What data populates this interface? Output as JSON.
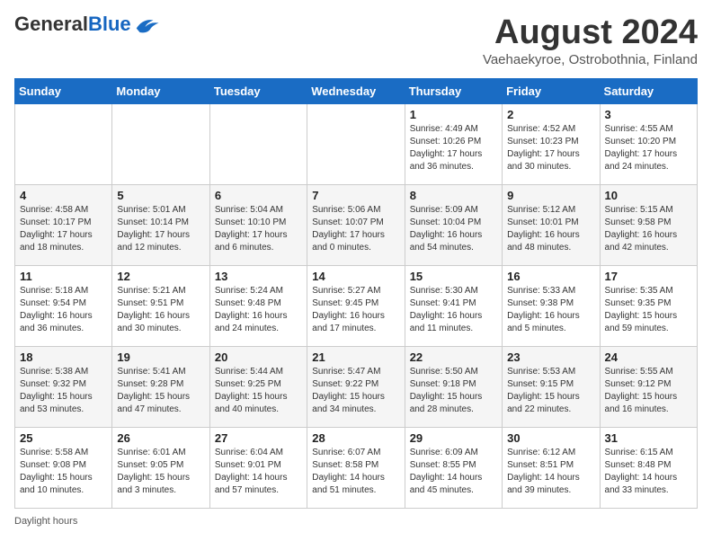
{
  "header": {
    "logo_general": "General",
    "logo_blue": "Blue",
    "month_year": "August 2024",
    "location": "Vaehaekyroe, Ostrobothnia, Finland"
  },
  "weekdays": [
    "Sunday",
    "Monday",
    "Tuesday",
    "Wednesday",
    "Thursday",
    "Friday",
    "Saturday"
  ],
  "weeks": [
    [
      {
        "day": "",
        "info": ""
      },
      {
        "day": "",
        "info": ""
      },
      {
        "day": "",
        "info": ""
      },
      {
        "day": "",
        "info": ""
      },
      {
        "day": "1",
        "info": "Sunrise: 4:49 AM\nSunset: 10:26 PM\nDaylight: 17 hours and 36 minutes."
      },
      {
        "day": "2",
        "info": "Sunrise: 4:52 AM\nSunset: 10:23 PM\nDaylight: 17 hours and 30 minutes."
      },
      {
        "day": "3",
        "info": "Sunrise: 4:55 AM\nSunset: 10:20 PM\nDaylight: 17 hours and 24 minutes."
      }
    ],
    [
      {
        "day": "4",
        "info": "Sunrise: 4:58 AM\nSunset: 10:17 PM\nDaylight: 17 hours and 18 minutes."
      },
      {
        "day": "5",
        "info": "Sunrise: 5:01 AM\nSunset: 10:14 PM\nDaylight: 17 hours and 12 minutes."
      },
      {
        "day": "6",
        "info": "Sunrise: 5:04 AM\nSunset: 10:10 PM\nDaylight: 17 hours and 6 minutes."
      },
      {
        "day": "7",
        "info": "Sunrise: 5:06 AM\nSunset: 10:07 PM\nDaylight: 17 hours and 0 minutes."
      },
      {
        "day": "8",
        "info": "Sunrise: 5:09 AM\nSunset: 10:04 PM\nDaylight: 16 hours and 54 minutes."
      },
      {
        "day": "9",
        "info": "Sunrise: 5:12 AM\nSunset: 10:01 PM\nDaylight: 16 hours and 48 minutes."
      },
      {
        "day": "10",
        "info": "Sunrise: 5:15 AM\nSunset: 9:58 PM\nDaylight: 16 hours and 42 minutes."
      }
    ],
    [
      {
        "day": "11",
        "info": "Sunrise: 5:18 AM\nSunset: 9:54 PM\nDaylight: 16 hours and 36 minutes."
      },
      {
        "day": "12",
        "info": "Sunrise: 5:21 AM\nSunset: 9:51 PM\nDaylight: 16 hours and 30 minutes."
      },
      {
        "day": "13",
        "info": "Sunrise: 5:24 AM\nSunset: 9:48 PM\nDaylight: 16 hours and 24 minutes."
      },
      {
        "day": "14",
        "info": "Sunrise: 5:27 AM\nSunset: 9:45 PM\nDaylight: 16 hours and 17 minutes."
      },
      {
        "day": "15",
        "info": "Sunrise: 5:30 AM\nSunset: 9:41 PM\nDaylight: 16 hours and 11 minutes."
      },
      {
        "day": "16",
        "info": "Sunrise: 5:33 AM\nSunset: 9:38 PM\nDaylight: 16 hours and 5 minutes."
      },
      {
        "day": "17",
        "info": "Sunrise: 5:35 AM\nSunset: 9:35 PM\nDaylight: 15 hours and 59 minutes."
      }
    ],
    [
      {
        "day": "18",
        "info": "Sunrise: 5:38 AM\nSunset: 9:32 PM\nDaylight: 15 hours and 53 minutes."
      },
      {
        "day": "19",
        "info": "Sunrise: 5:41 AM\nSunset: 9:28 PM\nDaylight: 15 hours and 47 minutes."
      },
      {
        "day": "20",
        "info": "Sunrise: 5:44 AM\nSunset: 9:25 PM\nDaylight: 15 hours and 40 minutes."
      },
      {
        "day": "21",
        "info": "Sunrise: 5:47 AM\nSunset: 9:22 PM\nDaylight: 15 hours and 34 minutes."
      },
      {
        "day": "22",
        "info": "Sunrise: 5:50 AM\nSunset: 9:18 PM\nDaylight: 15 hours and 28 minutes."
      },
      {
        "day": "23",
        "info": "Sunrise: 5:53 AM\nSunset: 9:15 PM\nDaylight: 15 hours and 22 minutes."
      },
      {
        "day": "24",
        "info": "Sunrise: 5:55 AM\nSunset: 9:12 PM\nDaylight: 15 hours and 16 minutes."
      }
    ],
    [
      {
        "day": "25",
        "info": "Sunrise: 5:58 AM\nSunset: 9:08 PM\nDaylight: 15 hours and 10 minutes."
      },
      {
        "day": "26",
        "info": "Sunrise: 6:01 AM\nSunset: 9:05 PM\nDaylight: 15 hours and 3 minutes."
      },
      {
        "day": "27",
        "info": "Sunrise: 6:04 AM\nSunset: 9:01 PM\nDaylight: 14 hours and 57 minutes."
      },
      {
        "day": "28",
        "info": "Sunrise: 6:07 AM\nSunset: 8:58 PM\nDaylight: 14 hours and 51 minutes."
      },
      {
        "day": "29",
        "info": "Sunrise: 6:09 AM\nSunset: 8:55 PM\nDaylight: 14 hours and 45 minutes."
      },
      {
        "day": "30",
        "info": "Sunrise: 6:12 AM\nSunset: 8:51 PM\nDaylight: 14 hours and 39 minutes."
      },
      {
        "day": "31",
        "info": "Sunrise: 6:15 AM\nSunset: 8:48 PM\nDaylight: 14 hours and 33 minutes."
      }
    ]
  ],
  "footer": {
    "daylight_label": "Daylight hours"
  }
}
